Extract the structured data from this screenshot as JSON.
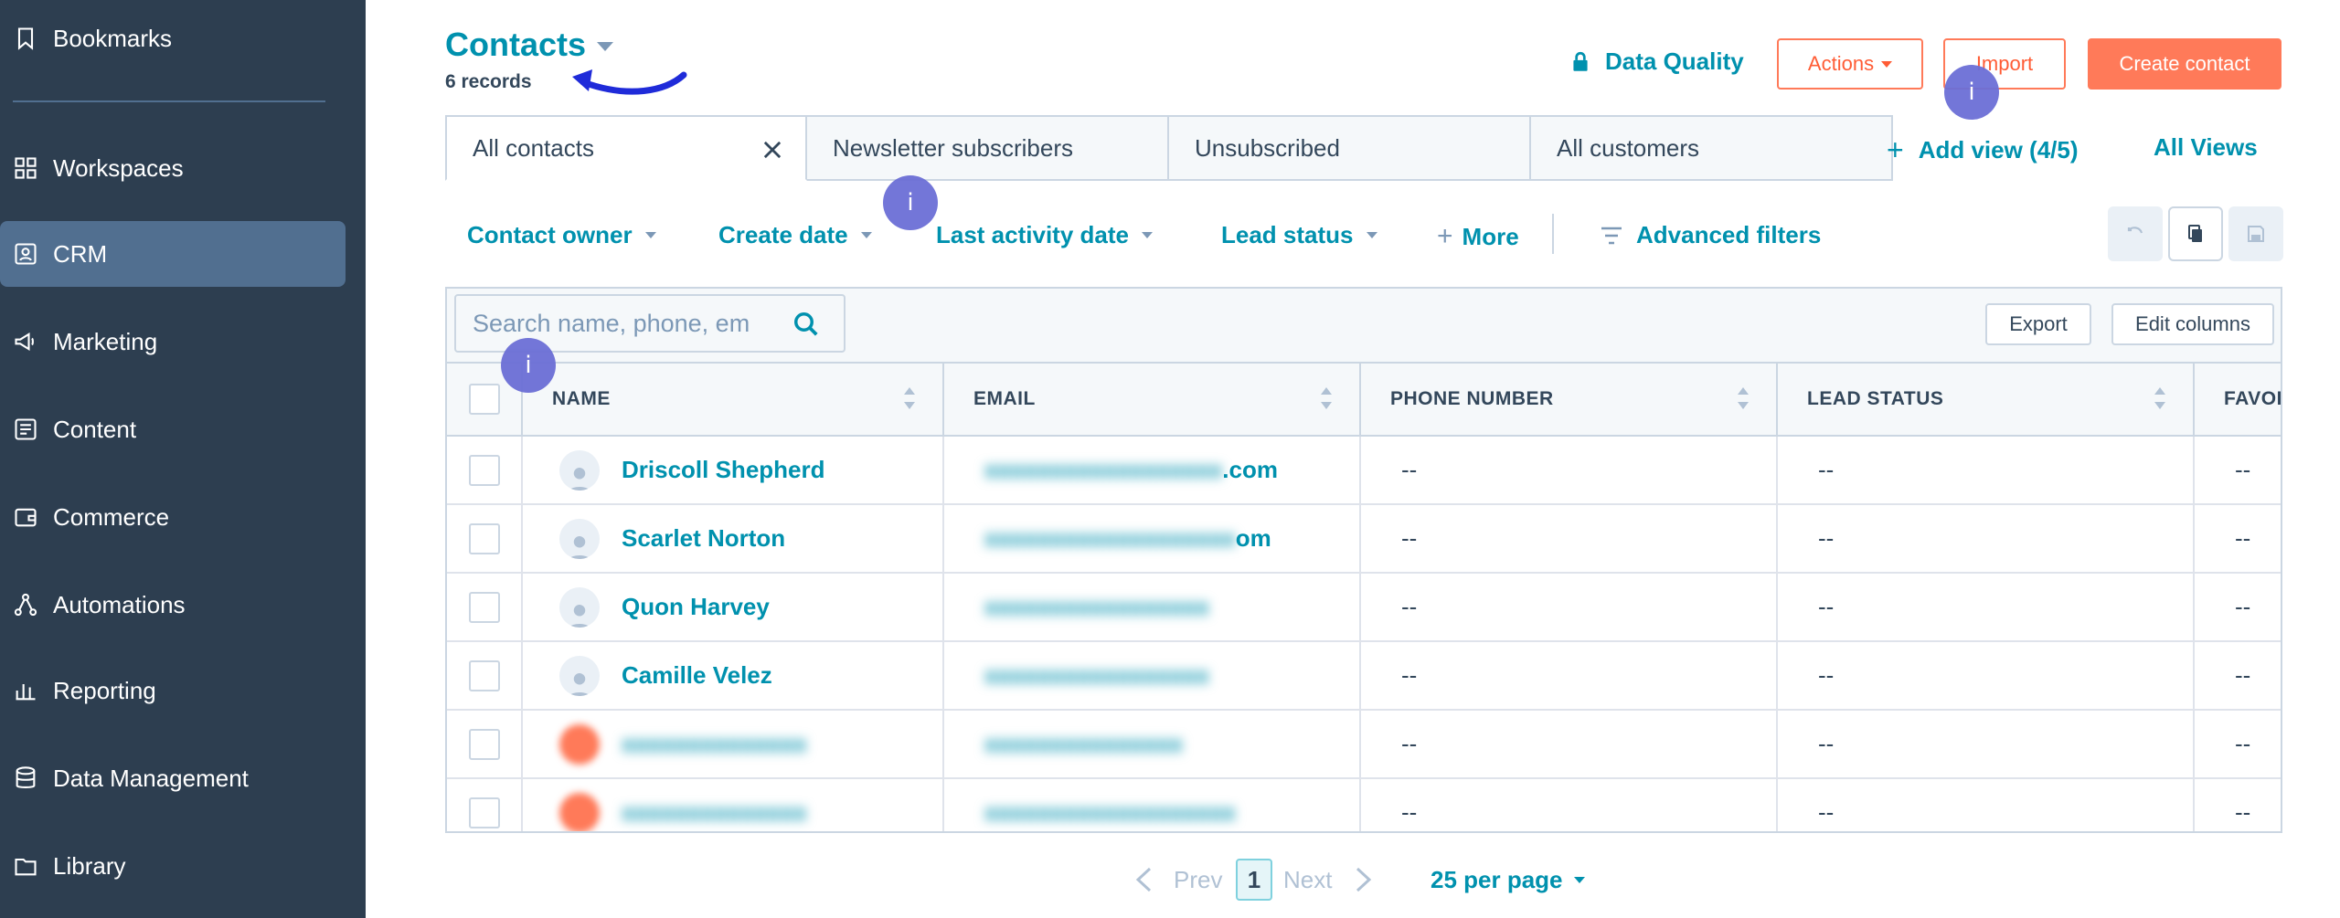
{
  "sidebar": {
    "items": [
      {
        "label": "Bookmarks",
        "icon": "bookmark-icon"
      },
      {
        "label": "Workspaces",
        "icon": "grid-icon"
      },
      {
        "label": "CRM",
        "icon": "contact-card-icon",
        "active": true
      },
      {
        "label": "Marketing",
        "icon": "megaphone-icon"
      },
      {
        "label": "Content",
        "icon": "content-icon"
      },
      {
        "label": "Commerce",
        "icon": "wallet-icon"
      },
      {
        "label": "Automations",
        "icon": "automation-icon"
      },
      {
        "label": "Reporting",
        "icon": "bar-chart-icon"
      },
      {
        "label": "Data Management",
        "icon": "database-icon"
      },
      {
        "label": "Library",
        "icon": "folder-icon"
      }
    ]
  },
  "header": {
    "title": "Contacts",
    "records": "6 records",
    "data_quality": "Data Quality",
    "actions_label": "Actions",
    "import_label": "Import",
    "create_label": "Create contact"
  },
  "tabs": [
    {
      "label": "All contacts",
      "active": true
    },
    {
      "label": "Newsletter subscribers"
    },
    {
      "label": "Unsubscribed"
    },
    {
      "label": "All customers"
    }
  ],
  "views": {
    "add_view": "Add view (4/5)",
    "all_views": "All Views"
  },
  "filters": {
    "contact_owner": "Contact owner",
    "create_date": "Create date",
    "last_activity": "Last activity date",
    "lead_status": "Lead status",
    "more": "More",
    "advanced": "Advanced filters"
  },
  "table": {
    "search_placeholder": "Search name, phone, em",
    "export_label": "Export",
    "edit_columns_label": "Edit columns",
    "columns": [
      "NAME",
      "EMAIL",
      "PHONE NUMBER",
      "LEAD STATUS",
      "FAVOR"
    ],
    "rows": [
      {
        "name": "Driscoll Shepherd",
        "email_visible": ".com",
        "phone": "--",
        "lead": "--",
        "fav": "--"
      },
      {
        "name": "Scarlet Norton",
        "email_visible": "om",
        "phone": "--",
        "lead": "--",
        "fav": "--"
      },
      {
        "name": "Quon Harvey",
        "email_visible": "",
        "phone": "--",
        "lead": "--",
        "fav": "--"
      },
      {
        "name": "Camille Velez",
        "email_visible": "",
        "phone": "--",
        "lead": "--",
        "fav": "--"
      },
      {
        "name": "",
        "email_visible": "",
        "phone": "--",
        "lead": "--",
        "fav": "--"
      },
      {
        "name": "",
        "email_visible": "",
        "phone": "--",
        "lead": "--",
        "fav": "--"
      }
    ]
  },
  "pagination": {
    "prev": "Prev",
    "page": "1",
    "next": "Next",
    "per_page": "25 per page"
  },
  "hints": [
    "i",
    "i",
    "i"
  ],
  "colors": {
    "sidebar_bg": "#2d3e50",
    "active_item": "#516f90",
    "link": "#0091ae",
    "accent": "#ff7a59",
    "hint": "#6c6fd6"
  }
}
